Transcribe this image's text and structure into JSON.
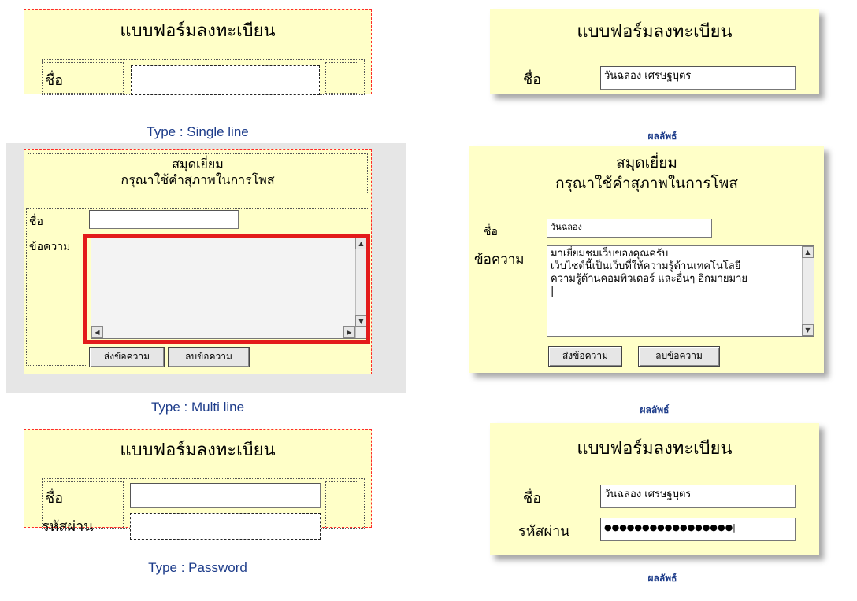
{
  "examples": {
    "single": {
      "design": {
        "title": "แบบฟอร์มลงทะเบียน",
        "name_label": "ชื่อ"
      },
      "result": {
        "title": "แบบฟอร์มลงทะเบียน",
        "name_label": "ชื่อ",
        "name_value": "วันฉลอง เศรษฐบุตร"
      },
      "caption": "Type :  Single line",
      "result_caption": "ผลลัพธ์"
    },
    "multi": {
      "design": {
        "title1": "สมุดเยี่ยม",
        "title2": "กรุณาใช้คำสุภาพในการโพส",
        "name_label": "ชื่อ",
        "message_label": "ข้อความ",
        "send_button": "ส่งข้อความ",
        "clear_button": "ลบข้อความ"
      },
      "result": {
        "title1": "สมุดเยี่ยม",
        "title2": "กรุณาใช้คำสุภาพในการโพส",
        "name_label": "ชื่อ",
        "name_value": "วันฉลอง",
        "message_label": "ข้อความ",
        "message_value": "มาเยี่ยมชมเว็บของคุณครับ\nเว็บไซต์นี้เป็นเว็บที่ให้ความรู้ด้านเทคโนโลยี\nความรู้ด้านคอมพิวเตอร์ และอื่นๆ อีกมายมาย\n|",
        "send_button": "ส่งข้อความ",
        "clear_button": "ลบข้อความ"
      },
      "caption": "Type :  Multi line",
      "result_caption": "ผลลัพธ์"
    },
    "password": {
      "design": {
        "title": "แบบฟอร์มลงทะเบียน",
        "name_label": "ชื่อ",
        "password_label": "รหัสผ่าน"
      },
      "result": {
        "title": "แบบฟอร์มลงทะเบียน",
        "name_label": "ชื่อ",
        "name_value": "วันฉลอง เศรษฐบุตร",
        "password_label": "รหัสผ่าน",
        "password_value": "●●●●●●●●●●●●●●●●●|"
      },
      "caption": "Type :  Password",
      "result_caption": "ผลลัพธ์"
    }
  },
  "colors": {
    "panel": "#ffffc8",
    "design_border": "#ff2a2a",
    "caption": "#1d3c8a",
    "highlight": "#e31b1b"
  }
}
